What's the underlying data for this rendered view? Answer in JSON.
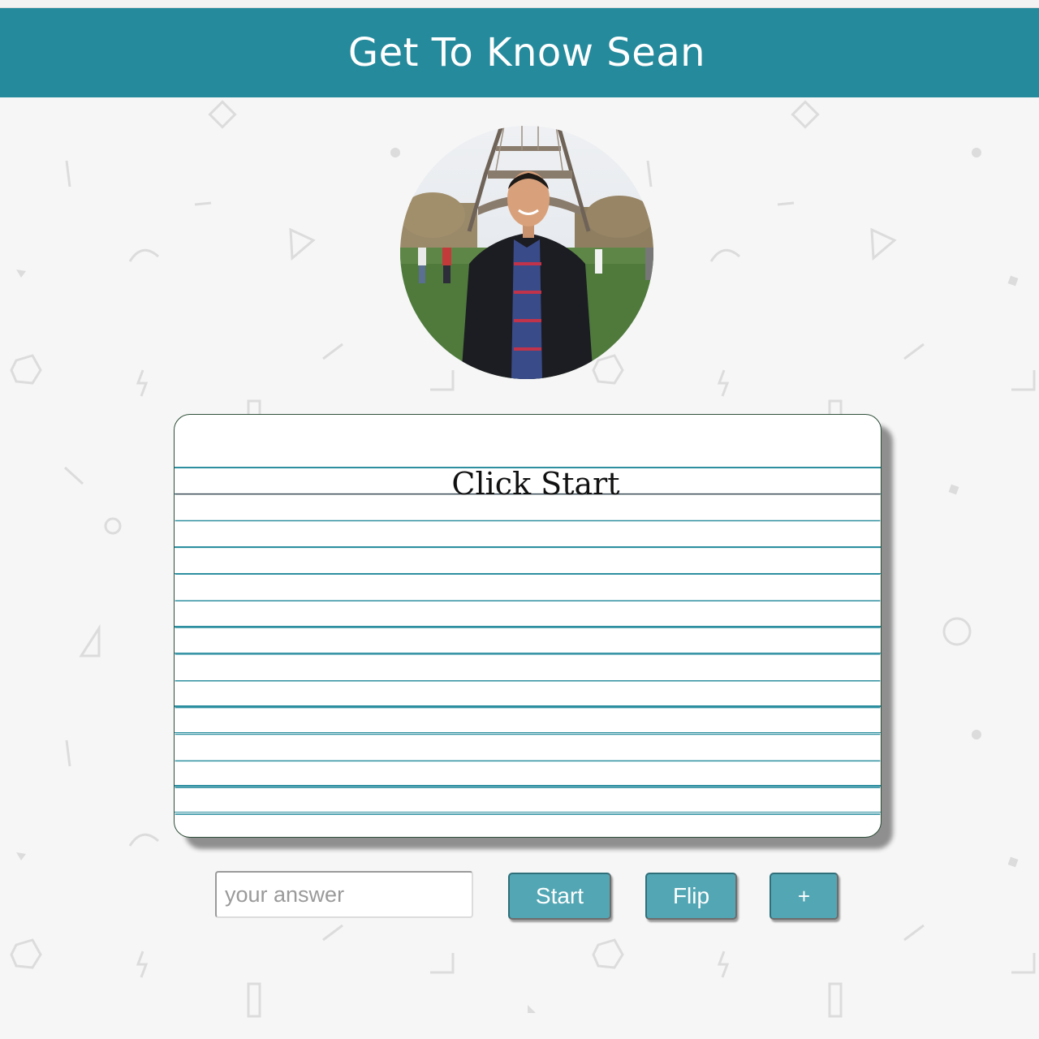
{
  "header": {
    "title": "Get To Know Sean"
  },
  "profile": {
    "image": "profile-photo-eiffel-tower"
  },
  "card": {
    "text": "Click Start"
  },
  "controls": {
    "answer_placeholder": "your answer",
    "answer_value": "",
    "start_label": "Start",
    "flip_label": "Flip",
    "add_label": "+"
  },
  "colors": {
    "header_bg": "#248a9c",
    "button_bg": "#53a7b5",
    "card_line": "#2d8fa0",
    "page_bg": "#f6f6f6"
  }
}
